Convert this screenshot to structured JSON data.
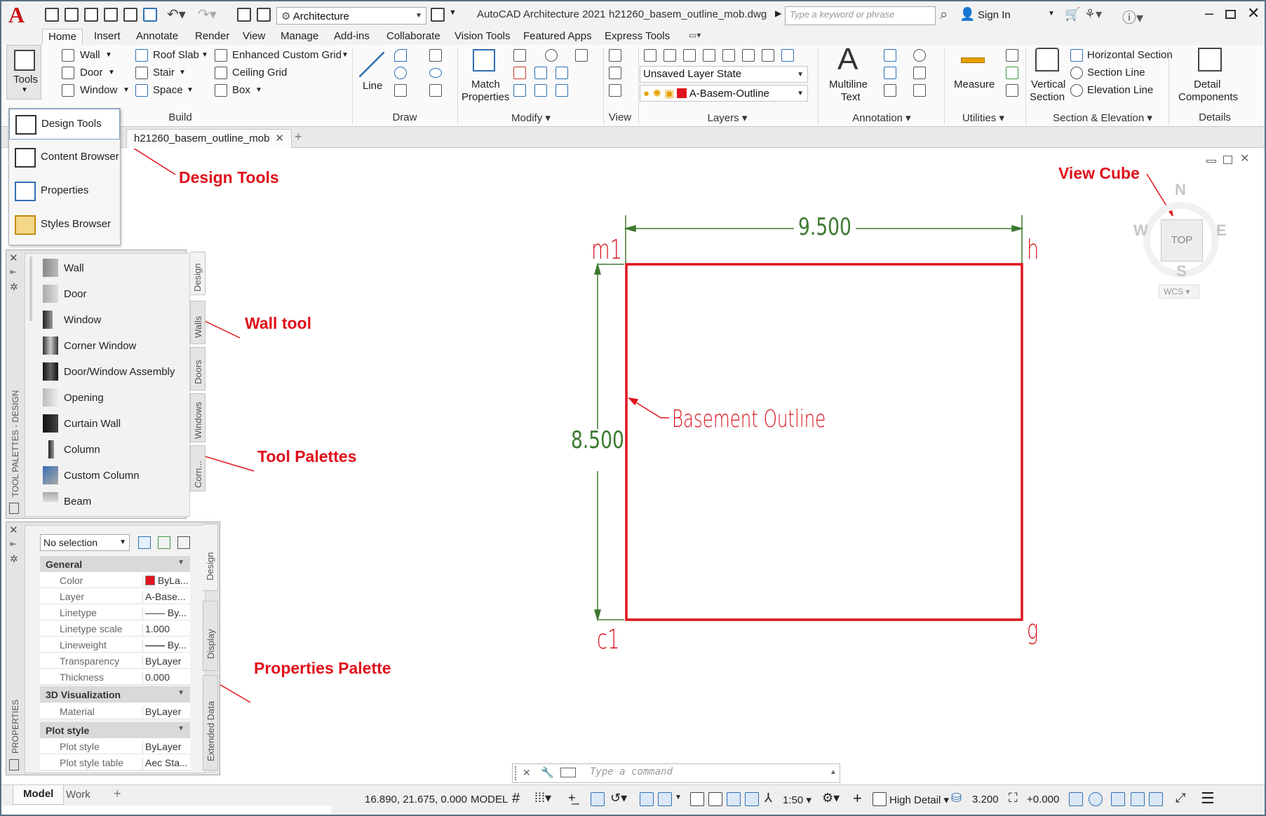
{
  "titlebar": {
    "workspace": "Architecture",
    "app_title": "AutoCAD Architecture 2021",
    "filename": "h21260_basem_outline_mob.dwg",
    "search_placeholder": "Type a keyword or phrase",
    "sign_in": "Sign In"
  },
  "ribbon_tabs": [
    "Home",
    "Insert",
    "Annotate",
    "Render",
    "View",
    "Manage",
    "Add-ins",
    "Collaborate",
    "Vision Tools",
    "Featured Apps",
    "Express Tools"
  ],
  "ribbon": {
    "tools_label": "Tools",
    "build": {
      "wall": "Wall",
      "door": "Door",
      "window": "Window",
      "roof_slab": "Roof Slab",
      "stair": "Stair",
      "space": "Space",
      "ecg": "Enhanced Custom Grid",
      "ceiling_grid": "Ceiling Grid",
      "box": "Box",
      "label": "Build"
    },
    "draw": {
      "line": "Line",
      "label": "Draw"
    },
    "modify": {
      "match": "Match",
      "properties": "Properties",
      "label": "Modify"
    },
    "view": {
      "label": "View"
    },
    "layers": {
      "state": "Unsaved Layer State",
      "current": "A-Basem-Outline",
      "label": "Layers"
    },
    "annotation": {
      "multiline": "Multiline",
      "text": "Text",
      "label": "Annotation"
    },
    "utilities": {
      "measure": "Measure",
      "label": "Utilities"
    },
    "section": {
      "vertical": "Vertical",
      "section": "Section",
      "horizontal": "Horizontal Section",
      "section_line": "Section Line",
      "elevation_line": "Elevation Line",
      "label": "Section & Elevation"
    },
    "details": {
      "detail": "Detail",
      "components": "Components",
      "label": "Details"
    }
  },
  "tools_dropdown": [
    "Design Tools",
    "Content Browser",
    "Properties",
    "Styles Browser"
  ],
  "doc_tab": "h21260_basem_outline_mob",
  "tool_palette": {
    "title": "TOOL PALETTES - DESIGN",
    "items": [
      "Wall",
      "Door",
      "Window",
      "Corner Window",
      "Door/Window Assembly",
      "Opening",
      "Curtain Wall",
      "Column",
      "Custom Column",
      "Beam"
    ],
    "tabs": [
      "Design",
      "Walls",
      "Doors",
      "Windows",
      "Corn..."
    ]
  },
  "properties": {
    "title": "PROPERTIES",
    "selection": "No selection",
    "sections": [
      {
        "name": "General",
        "rows": [
          [
            "Color",
            "ByLa..."
          ],
          [
            "Layer",
            "A-Base..."
          ],
          [
            "Linetype",
            "By..."
          ],
          [
            "Linetype scale",
            "1.000"
          ],
          [
            "Lineweight",
            "By..."
          ],
          [
            "Transparency",
            "ByLayer"
          ],
          [
            "Thickness",
            "0.000"
          ]
        ]
      },
      {
        "name": "3D Visualization",
        "rows": [
          [
            "Material",
            "ByLayer"
          ]
        ]
      },
      {
        "name": "Plot style",
        "rows": [
          [
            "Plot style",
            "ByLayer"
          ],
          [
            "Plot style table",
            "Aec Sta..."
          ]
        ]
      }
    ],
    "tabs": [
      "Design",
      "Display",
      "Extended Data"
    ]
  },
  "drawing": {
    "width_dim": "9.500",
    "height_dim": "8.500",
    "corners": {
      "top_left": "m1",
      "top_right": "h",
      "bottom_left": "c1",
      "bottom_right": "g"
    },
    "label": "Basement  Outline",
    "outline_color": "#e0141c",
    "dim_color": "#3b7a2f"
  },
  "viewcube": {
    "n": "N",
    "s": "S",
    "e": "E",
    "w": "W",
    "face": "TOP",
    "wcs": "WCS"
  },
  "annotations": {
    "design_tools": "Design Tools",
    "view_cube": "View Cube",
    "wall_tool": "Wall tool",
    "tool_palettes": "Tool Palettes",
    "properties_palette": "Properties Palette"
  },
  "command_placeholder": "Type a command",
  "layout_tabs": [
    "Model",
    "Work"
  ],
  "status": {
    "coords": "16.890, 21.675, 0.000",
    "model": "MODEL",
    "scale": "1:50",
    "detail": "High Detail",
    "elevation": "3.200",
    "offset": "+0.000"
  }
}
